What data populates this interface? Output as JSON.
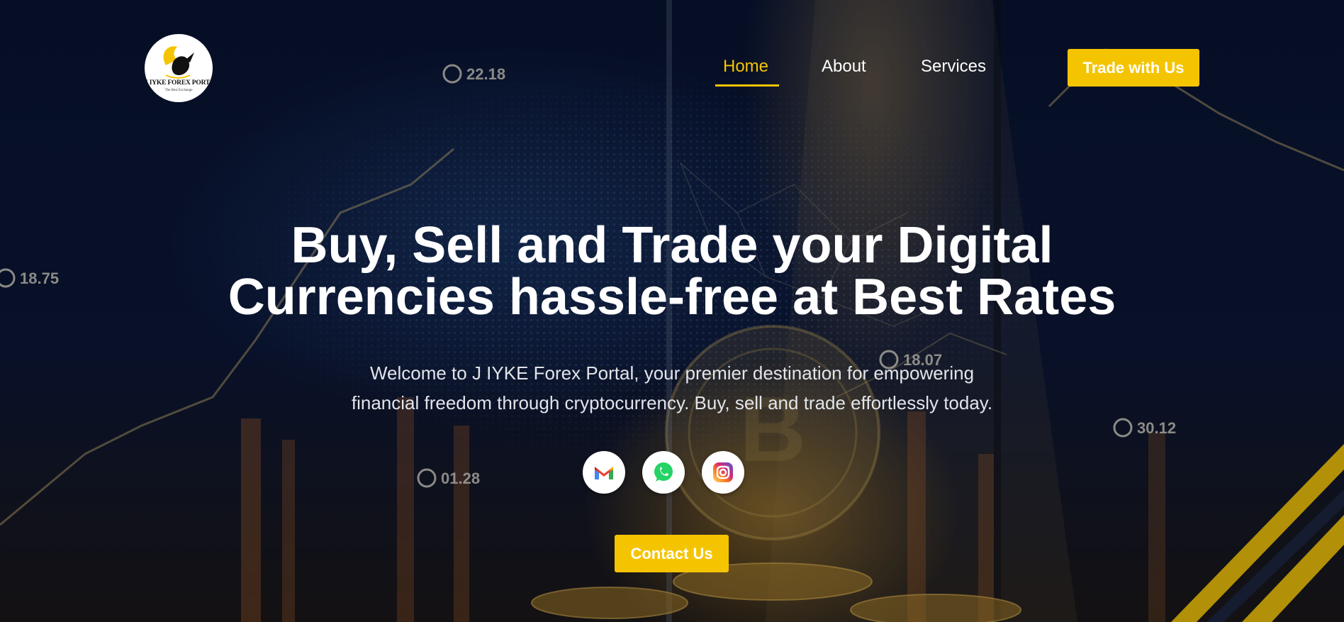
{
  "brand": {
    "logo_text": "J IYKE FOREX PORTAL",
    "logo_tagline": "The Best Exchange"
  },
  "nav": {
    "items": [
      {
        "label": "Home",
        "active": true
      },
      {
        "label": "About",
        "active": false
      },
      {
        "label": "Services",
        "active": false
      }
    ],
    "cta_label": "Trade with Us"
  },
  "hero": {
    "title_line1": "Buy, Sell and Trade your Digital",
    "title_line2": "Currencies hassle-free at Best Rates",
    "subtitle_line1": "Welcome to J IYKE Forex Portal, your premier destination for empowering",
    "subtitle_line2": "financial freedom through cryptocurrency. Buy, sell and trade effortlessly today.",
    "contact_label": "Contact Us"
  },
  "social": [
    {
      "icon": "gmail-icon"
    },
    {
      "icon": "whatsapp-icon"
    },
    {
      "icon": "instagram-icon"
    }
  ],
  "background_labels": [
    "22.18",
    "18.75",
    "18.07",
    "30.12",
    "01.28"
  ],
  "colors": {
    "accent": "#f5c400",
    "background": "#07102a",
    "text": "#ffffff"
  }
}
